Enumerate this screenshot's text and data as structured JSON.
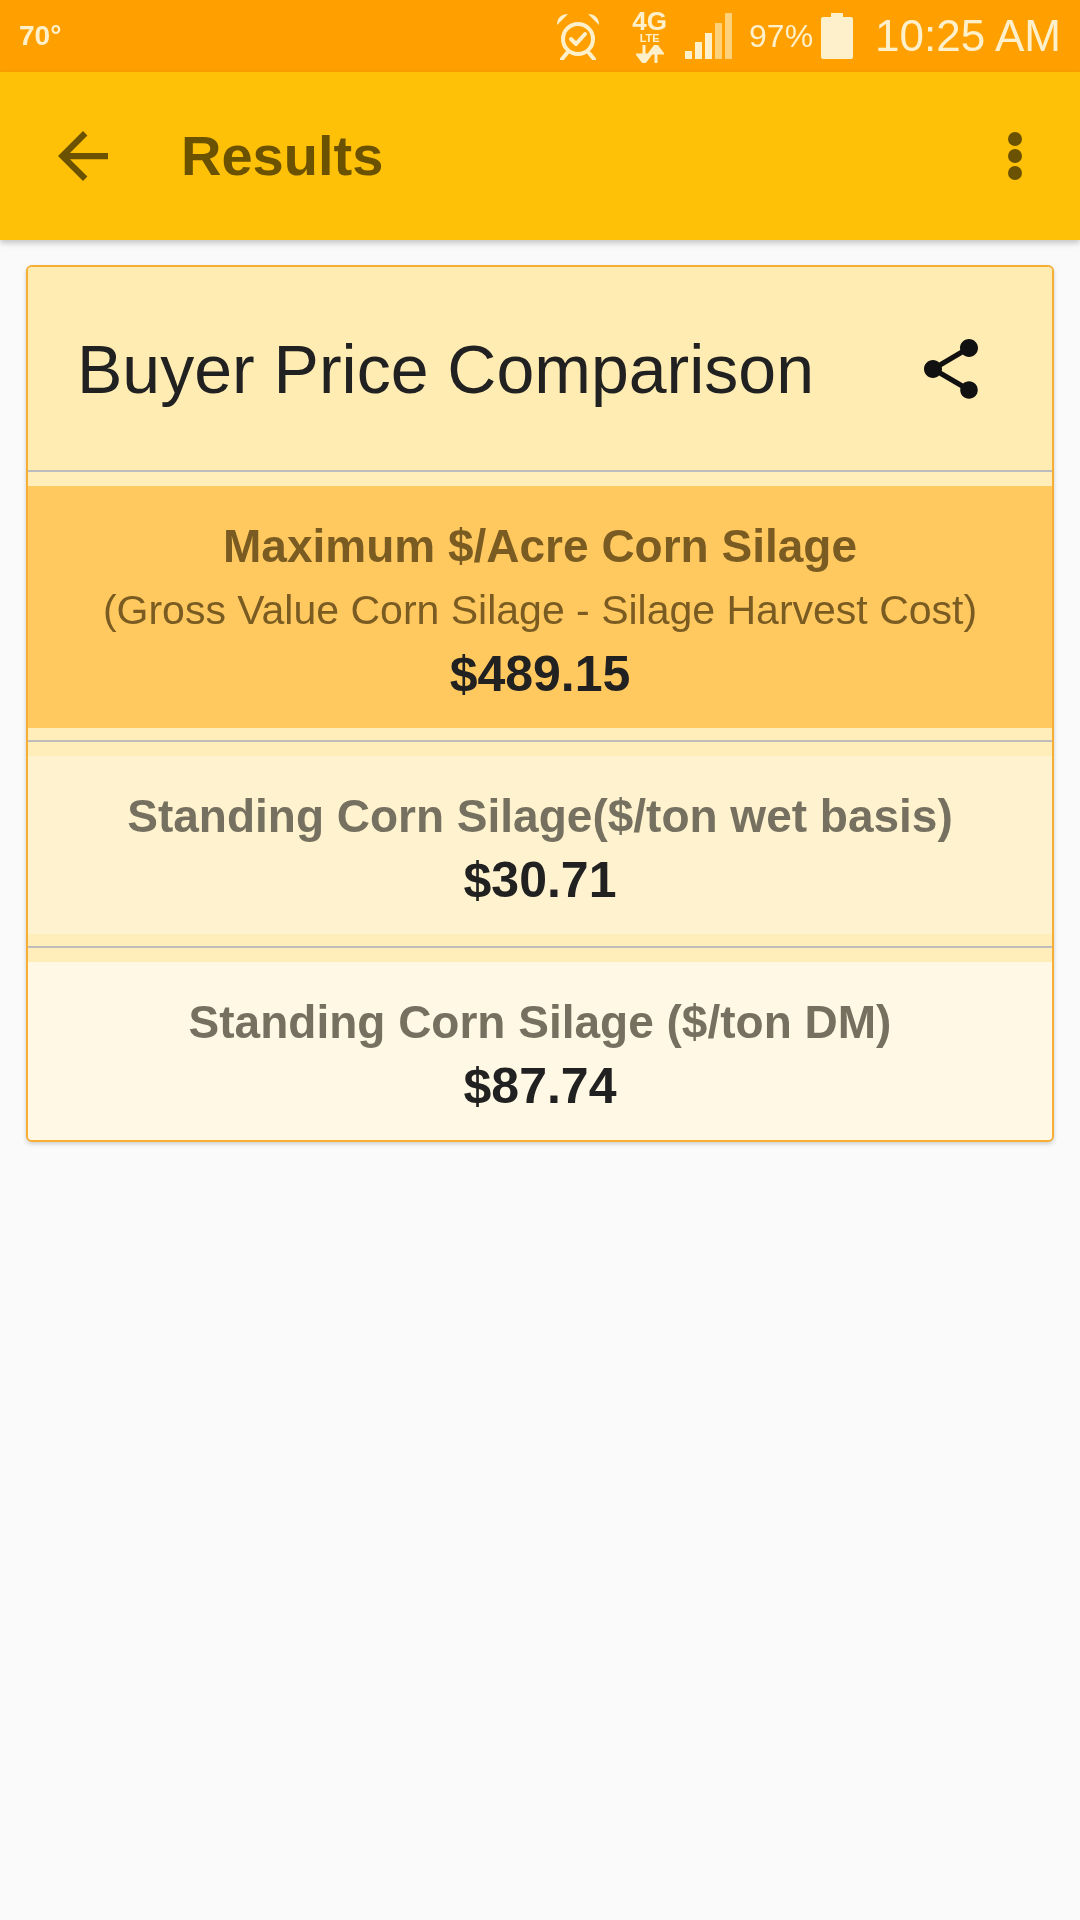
{
  "status_bar": {
    "temperature": "70°",
    "network": "4G",
    "network_sub": "LTE",
    "battery": "97%",
    "time": "10:25 AM"
  },
  "app_bar": {
    "title": "Results"
  },
  "card": {
    "title": "Buyer Price Comparison",
    "rows": [
      {
        "title": "Maximum $/Acre Corn Silage",
        "subtitle": "(Gross Value Corn Silage - Silage Harvest Cost)",
        "value": "$489.15",
        "highlighted": true,
        "color": "#ffc960"
      },
      {
        "title": "Standing Corn Silage($/ton wet basis)",
        "value": "$30.71",
        "highlighted": false,
        "color": "#fff3cf"
      },
      {
        "title": "Standing Corn Silage ($/ton DM)",
        "value": "$87.74",
        "highlighted": false,
        "color": "#fff8e4"
      }
    ]
  }
}
